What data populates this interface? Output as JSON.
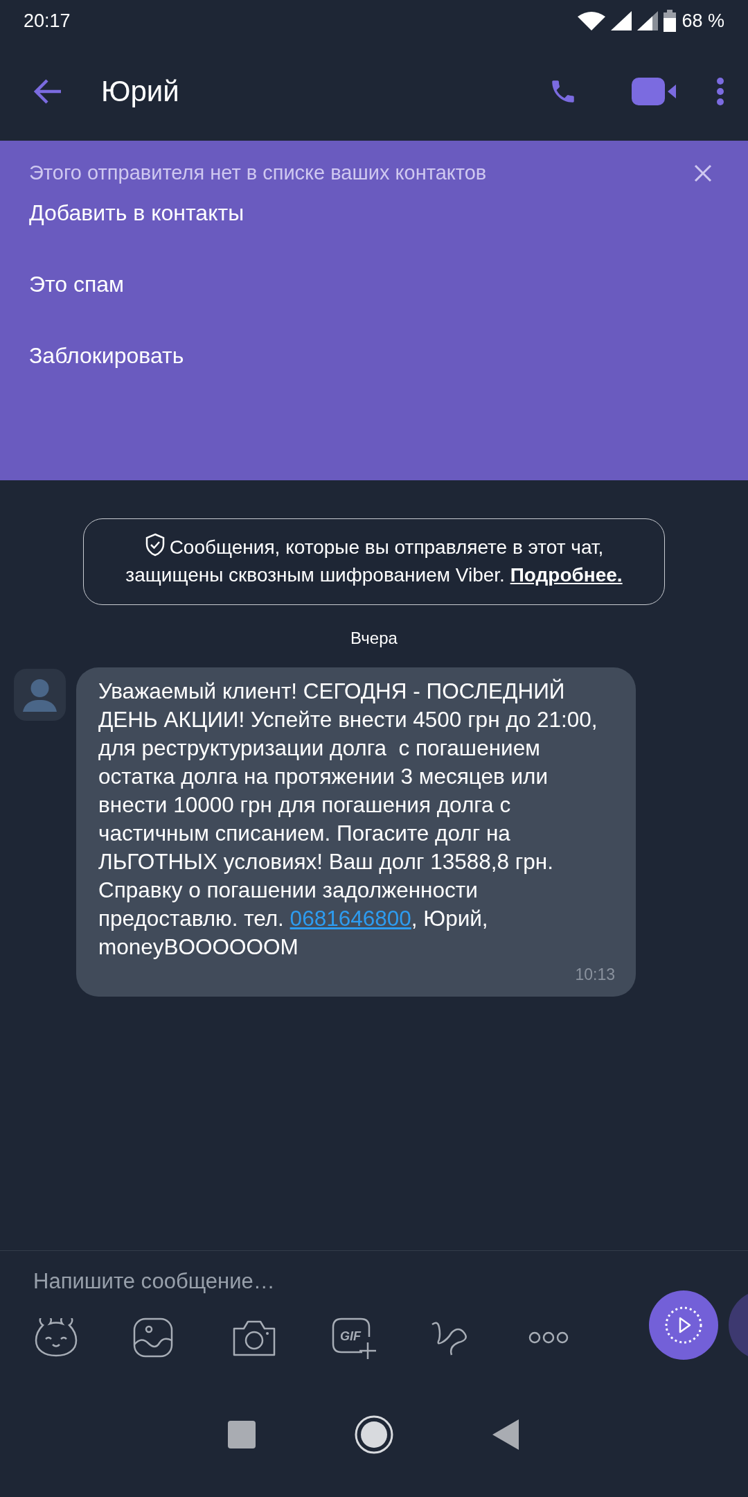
{
  "status_bar": {
    "time": "20:17",
    "battery": "68 %"
  },
  "app_bar": {
    "title": "Юрий"
  },
  "unknown_sender_banner": {
    "notice": "Этого отправителя нет в списке ваших контактов",
    "actions": [
      "Добавить в контакты",
      "Это спам",
      "Заблокировать"
    ]
  },
  "encryption_notice": {
    "text": "Сообщения, которые вы отправляете в этот чат, защищены сквозным шифрованием Viber.",
    "link": "Подробнее."
  },
  "date_separator": "Вчера",
  "messages": [
    {
      "text_before": "Уважаемый клиент! СЕГОДНЯ - ПОСЛЕДНИЙ ДЕНЬ АКЦИИ! Успейте внести 4500 грн до 21:00, для реструктуризации долга  с погашением остатка долга на протяжении 3 месяцев или внести 10000 грн для погашения долга с частичным списанием. Погасите долг на ЛЬГОТНЫХ условиях! Ваш долг 13588,8 грн. Справку о погашении задолженности предоставлю. тел. ",
      "link": "0681646800",
      "text_after": ", Юрий, moneyBOOOOOOM",
      "time": "10:13"
    }
  ],
  "composer": {
    "placeholder": "Напишите сообщение…",
    "gif_label": "GIF"
  }
}
